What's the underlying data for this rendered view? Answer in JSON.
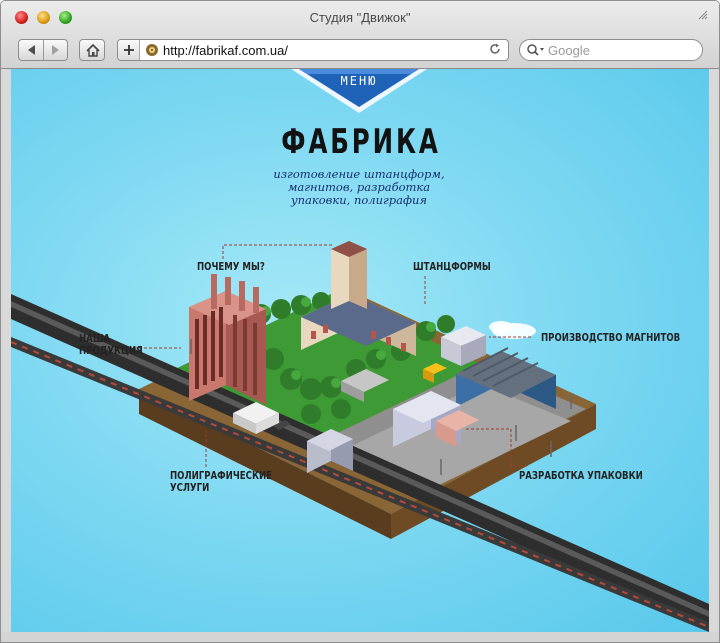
{
  "window": {
    "title": "Студия \"Движок\""
  },
  "toolbar": {
    "url": "http://fabrikaf.com.ua/",
    "search_placeholder": "Google"
  },
  "page": {
    "menu_label": "МЕНЮ",
    "title": "ФАБРИКА",
    "subtitle": "изготовление штанцформ, магнитов, разработка упаковки, полиграфия",
    "links": [
      {
        "label": "ПОЧЕМУ МЫ?"
      },
      {
        "label": "ШТАНЦФОРМЫ"
      },
      {
        "label": "НАША ПРОДУКЦИЯ"
      },
      {
        "label": "ПРОИЗВОДСТВО МАГНИТОВ"
      },
      {
        "label": "ПОЛИГРАФИЧЕСКИЕ УСЛУГИ"
      },
      {
        "label": "РАЗРАБОТКА УПАКОВКИ"
      }
    ]
  },
  "colors": {
    "sky": "#7fd9f2",
    "menu_blue": "#1f63b8",
    "subtitle_blue": "#14306e",
    "grass": "#3d9a34",
    "road": "#2e2e2e"
  }
}
